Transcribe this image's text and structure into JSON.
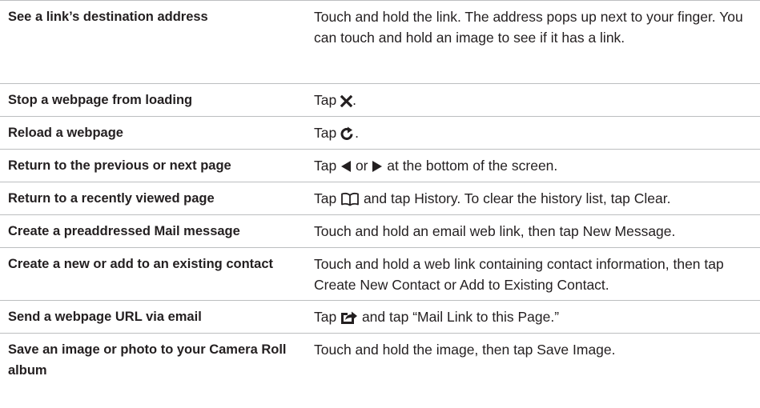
{
  "rows": [
    {
      "task": "See a link’s destination address",
      "action": "Touch and hold the link. The address pops up next to your finger. You can touch and hold an image to see if it has a link."
    },
    {
      "task": "Stop a webpage from loading",
      "action_pre": "Tap ",
      "action_post": ".",
      "icon": "stop-x-icon"
    },
    {
      "task": "Reload a webpage",
      "action_pre": "Tap ",
      "action_post": ".",
      "icon": "reload-icon"
    },
    {
      "task": "Return to the previous or next page",
      "action_pre": "Tap ",
      "action_mid": " or ",
      "action_post": " at the bottom of the screen.",
      "icons": [
        "back-triangle-icon",
        "forward-triangle-icon"
      ]
    },
    {
      "task": "Return to a recently viewed page",
      "action_pre": "Tap ",
      "action_post": " and tap History. To clear the history list, tap Clear.",
      "icon": "bookmarks-book-icon"
    },
    {
      "task": "Create a preaddressed Mail message",
      "action": "Touch and hold an email web link, then tap New Message."
    },
    {
      "task": "Create a new or add to an existing contact",
      "action": "Touch and hold a web link containing contact information, then tap Create New Contact or Add to Existing Contact."
    },
    {
      "task": "Send a webpage URL via email",
      "action_pre": "Tap ",
      "action_post": " and tap “Mail Link to this Page.”",
      "icon": "share-action-icon"
    },
    {
      "task": "Save an image or photo to your Camera Roll album",
      "action": "Touch and hold the image, then tap Save Image."
    }
  ]
}
